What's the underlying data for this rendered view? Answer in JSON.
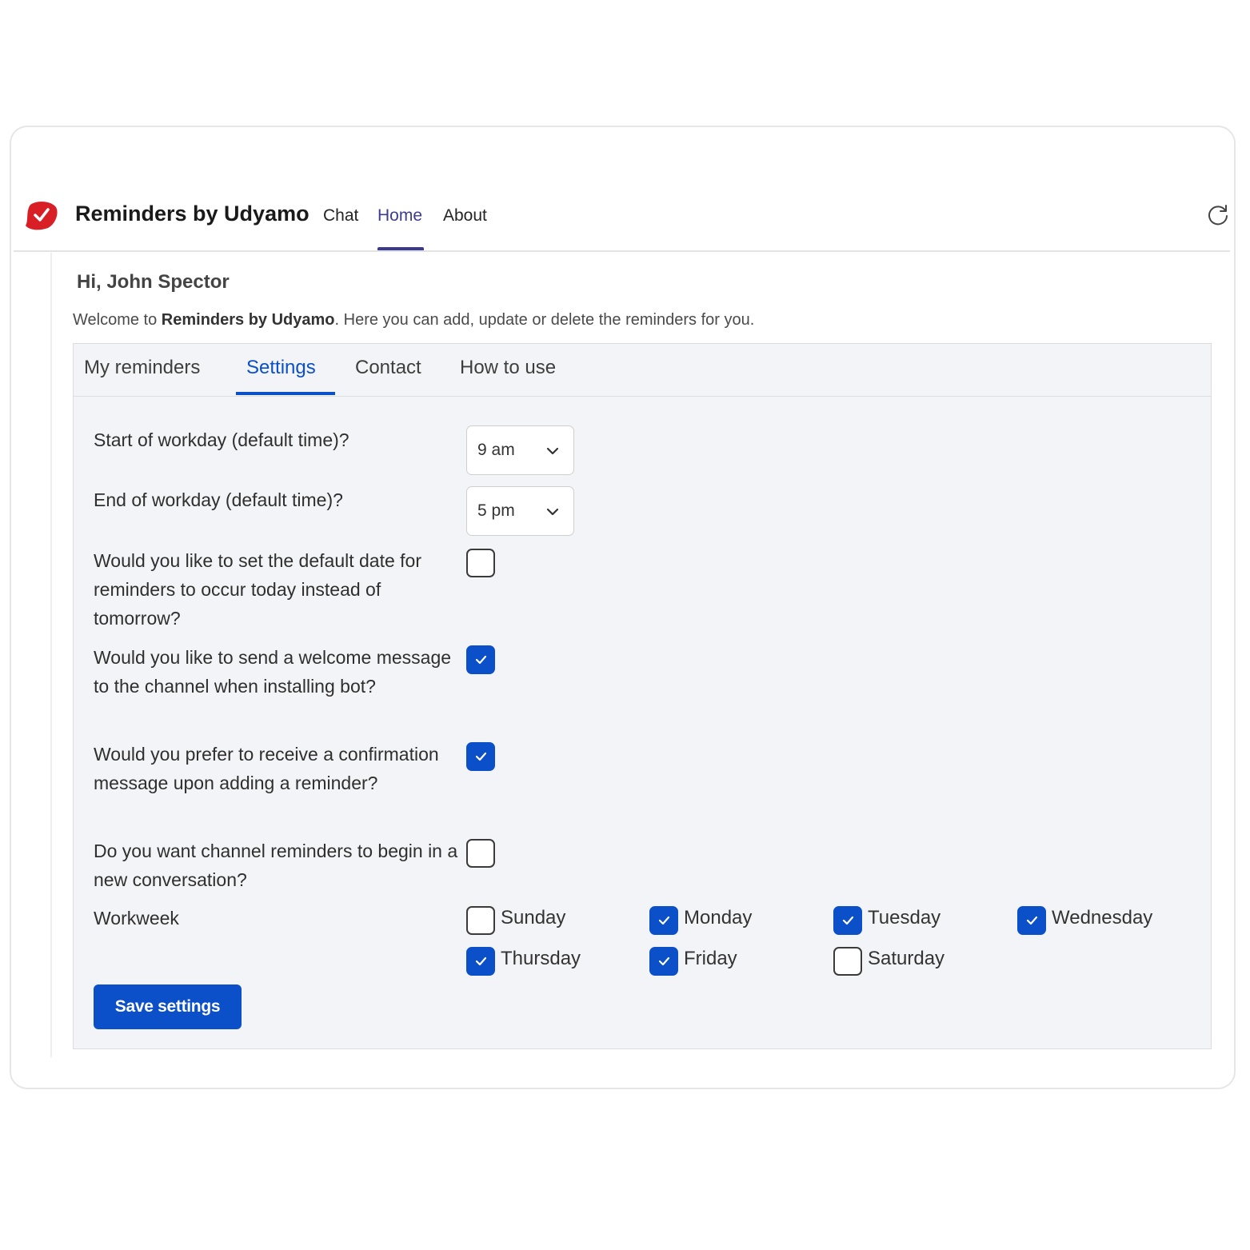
{
  "app": {
    "title": "Reminders by Udyamo",
    "tabs": [
      {
        "label": "Chat",
        "active": false
      },
      {
        "label": "Home",
        "active": true
      },
      {
        "label": "About",
        "active": false
      }
    ],
    "accent_color": "#3d3890",
    "logo_color": "#d91f26"
  },
  "page": {
    "greeting": "Hi, John Spector",
    "welcome_prefix": "Welcome to ",
    "welcome_app": "Reminders by Udyamo",
    "welcome_suffix": ". Here you can add, update or delete the reminders for you."
  },
  "tabs": [
    {
      "label": "My reminders",
      "active": false
    },
    {
      "label": "Settings",
      "active": true
    },
    {
      "label": "Contact",
      "active": false
    },
    {
      "label": "How to use",
      "active": false
    }
  ],
  "settings": {
    "start_workday": {
      "label": "Start of workday (default time)?",
      "value": "9 am"
    },
    "end_workday": {
      "label": "End of workday (default time)?",
      "value": "5 pm"
    },
    "default_today": {
      "label": "Would you like to set the default date for reminders to occur today instead of tomorrow?",
      "checked": false
    },
    "welcome_message": {
      "label": "Would you like to send a welcome message to the channel when installing bot?",
      "checked": true
    },
    "confirmation_message": {
      "label": "Would you prefer to receive a confirmation message upon adding a reminder?",
      "checked": true
    },
    "new_conversation": {
      "label": "Do you want channel reminders to begin in a new conversation?",
      "checked": false
    },
    "workweek": {
      "label": "Workweek",
      "days": [
        {
          "label": "Sunday",
          "checked": false
        },
        {
          "label": "Monday",
          "checked": true
        },
        {
          "label": "Tuesday",
          "checked": true
        },
        {
          "label": "Wednesday",
          "checked": true
        },
        {
          "label": "Thursday",
          "checked": true
        },
        {
          "label": "Friday",
          "checked": true
        },
        {
          "label": "Saturday",
          "checked": false
        }
      ]
    },
    "save_label": "Save settings"
  },
  "colors": {
    "primary": "#0b4fc9",
    "panel_bg": "#f3f4f7"
  }
}
